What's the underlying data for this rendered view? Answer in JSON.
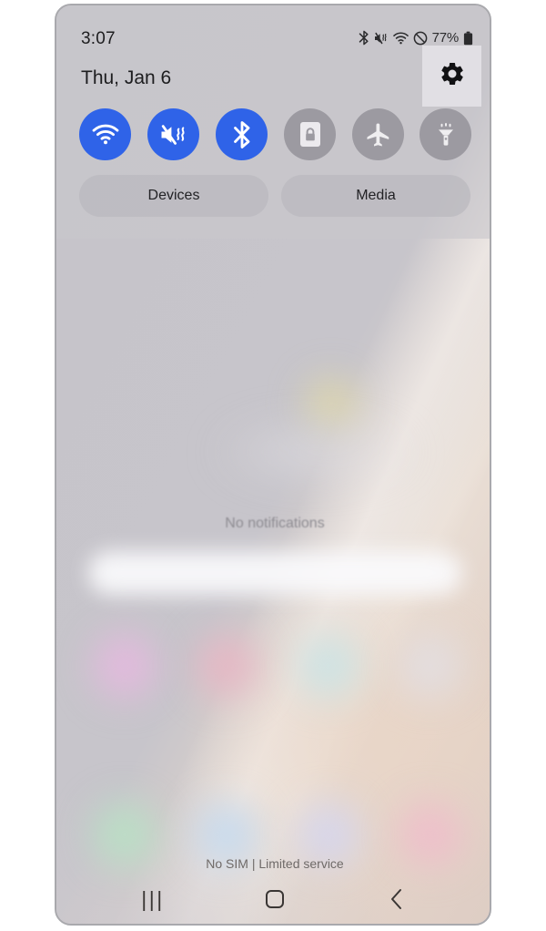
{
  "status_bar": {
    "time": "3:07",
    "battery_percent": "77%",
    "icons": [
      {
        "name": "bluetooth-icon",
        "label": "Bluetooth"
      },
      {
        "name": "mute-vibrate-icon",
        "label": "Sound off / vibrate"
      },
      {
        "name": "wifi-icon",
        "label": "Wi-Fi"
      },
      {
        "name": "do-not-disturb-icon",
        "label": "Do not disturb"
      },
      {
        "name": "battery-icon",
        "label": "Battery"
      }
    ]
  },
  "quick_settings": {
    "date": "Thu, Jan 6",
    "settings_icon": "gear-icon",
    "toggles": [
      {
        "id": "wifi",
        "icon": "wifi-icon",
        "label": "Wi-Fi",
        "state": "on"
      },
      {
        "id": "sound",
        "icon": "mute-vibrate-icon",
        "label": "Mute",
        "state": "on"
      },
      {
        "id": "bluetooth",
        "icon": "bluetooth-icon",
        "label": "Bluetooth",
        "state": "on"
      },
      {
        "id": "rotation",
        "icon": "portrait-lock-icon",
        "label": "Portrait",
        "state": "off"
      },
      {
        "id": "airplane",
        "icon": "airplane-icon",
        "label": "Airplane mode",
        "state": "off"
      },
      {
        "id": "flashlight",
        "icon": "flashlight-icon",
        "label": "Flashlight",
        "state": "off"
      }
    ],
    "shortcuts": {
      "devices_label": "Devices",
      "media_label": "Media"
    }
  },
  "notifications": {
    "empty_text": "No notifications"
  },
  "home_screen": {
    "carrier_status": "No SIM | Limited service",
    "wallpaper_icon_colors_row1": [
      "#e7b8e0",
      "#e9b5c4",
      "#c9e4e6",
      "#e2dee2"
    ],
    "wallpaper_icon_colors_row2": [
      "#b7e2c4",
      "#c3d9ef",
      "#d4d6f0",
      "#f0bccb"
    ]
  },
  "nav_bar": {
    "recents_glyph": "|||",
    "buttons": [
      {
        "name": "nav-recents-button",
        "label": "Recents"
      },
      {
        "name": "nav-home-button",
        "label": "Home"
      },
      {
        "name": "nav-back-button",
        "label": "Back"
      }
    ]
  },
  "theme": {
    "accent_blue": "#2f63e8",
    "toggle_off_gray": "#9c9aa1",
    "text_primary": "#1d1d1f",
    "text_muted": "#8e8c92"
  }
}
